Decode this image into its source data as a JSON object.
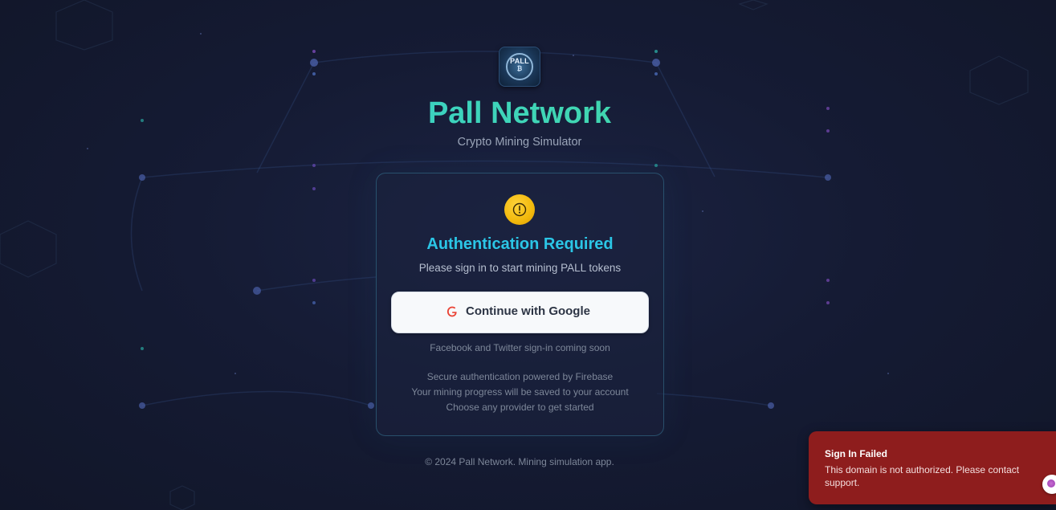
{
  "app": {
    "logo_text": "PALL",
    "logo_sub": "₿",
    "title": "Pall Network",
    "subtitle": "Crypto Mining Simulator"
  },
  "auth_card": {
    "icon": "alert-circle-icon",
    "title": "Authentication Required",
    "description": "Please sign in to start mining PALL tokens",
    "google_button_label": "Continue with Google",
    "google_icon": "google-g-icon",
    "coming_soon": "Facebook and Twitter sign-in coming soon",
    "info_lines": [
      "Secure authentication powered by Firebase",
      "Your mining progress will be saved to your account",
      "Choose any provider to get started"
    ]
  },
  "footer": {
    "copyright": "© 2024 Pall Network. Mining simulation app."
  },
  "toast": {
    "title": "Sign In Failed",
    "message": "This domain is not authorized. Please contact support."
  },
  "colors": {
    "background": "#151b34",
    "accent_cyan": "#2bc6e6",
    "accent_green": "#45d98a",
    "warning_yellow": "#f2b90c",
    "error_red": "#8e1d1d"
  }
}
